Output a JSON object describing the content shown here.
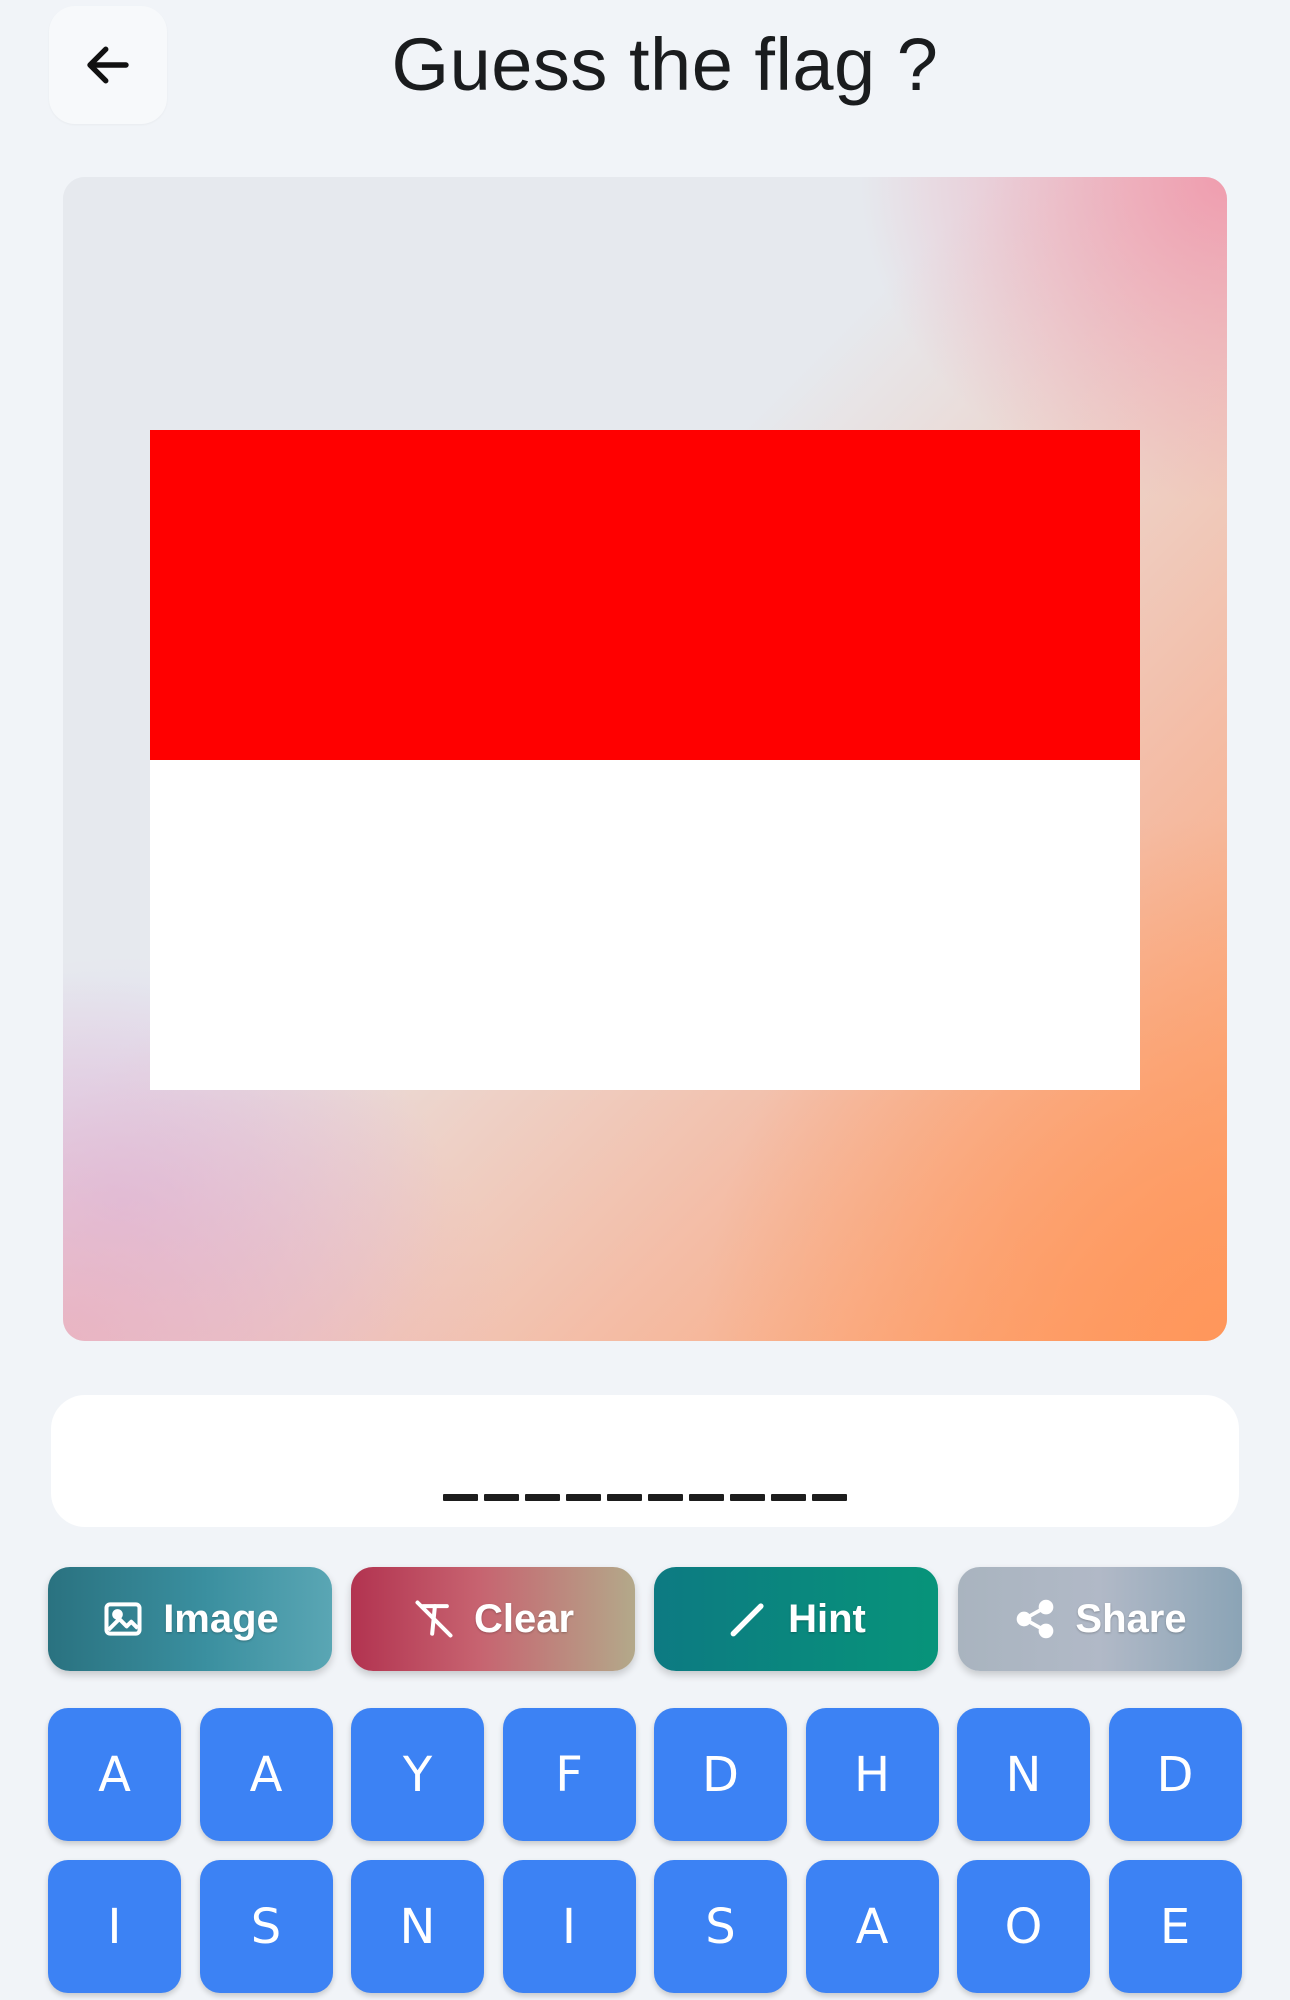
{
  "header": {
    "title": "Guess the flag ?",
    "back_icon": "arrow-left-icon"
  },
  "flag": {
    "top_color": "#ff0000",
    "bottom_color": "#ffffff"
  },
  "answer": {
    "slot_count": 10
  },
  "actions": {
    "image_label": "Image",
    "clear_label": "Clear",
    "hint_label": "Hint",
    "share_label": "Share"
  },
  "keyboard": {
    "row1": [
      "A",
      "A",
      "Y",
      "F",
      "D",
      "H",
      "N",
      "D"
    ],
    "row2": [
      "I",
      "S",
      "N",
      "I",
      "S",
      "A",
      "O",
      "E"
    ]
  },
  "colors": {
    "key_bg": "#3c82f4",
    "page_bg": "#f1f4f8"
  }
}
